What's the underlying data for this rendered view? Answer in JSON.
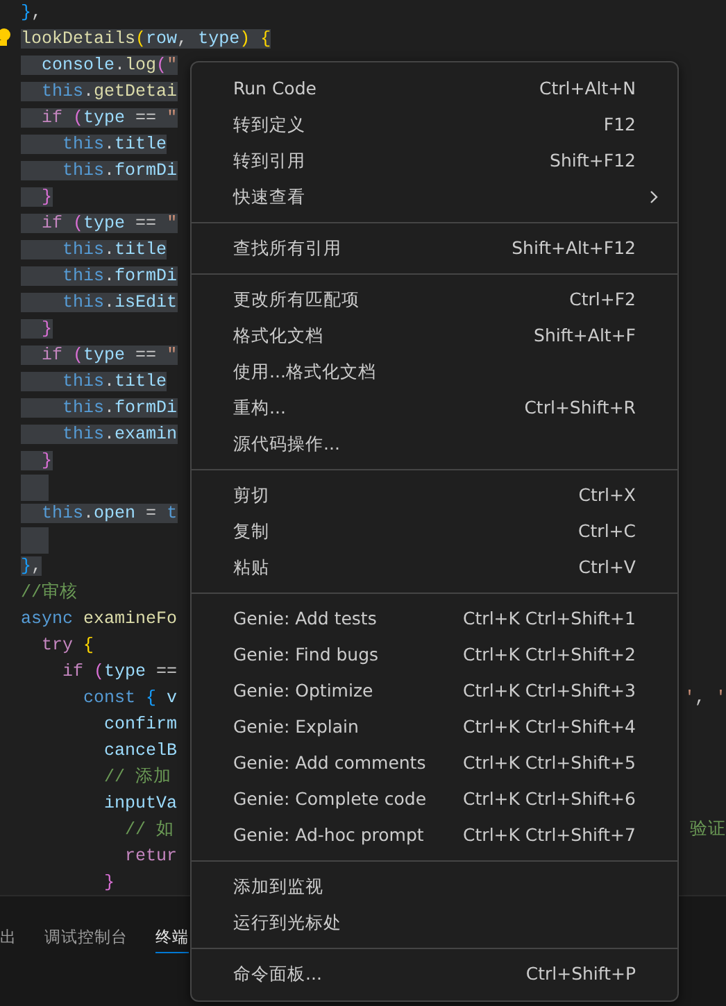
{
  "editor": {
    "lines": [
      {
        "selected": false,
        "tokens": [
          {
            "kind": "b3",
            "text": "}"
          },
          {
            "kind": "plain",
            "text": ","
          }
        ]
      },
      {
        "selected": true,
        "tokens": [
          {
            "kind": "fn",
            "text": "lookDetails"
          },
          {
            "kind": "b1",
            "text": "("
          },
          {
            "kind": "var",
            "text": "row"
          },
          {
            "kind": "plain",
            "text": ", "
          },
          {
            "kind": "var",
            "text": "type"
          },
          {
            "kind": "b1",
            "text": ")"
          },
          {
            "kind": "b1",
            "text": " {"
          }
        ]
      },
      {
        "selected": true,
        "tokens": [
          {
            "kind": "var",
            "text": "  console"
          },
          {
            "kind": "plain",
            "text": "."
          },
          {
            "kind": "fn",
            "text": "log"
          },
          {
            "kind": "b2",
            "text": "("
          },
          {
            "kind": "str",
            "text": "\""
          }
        ]
      },
      {
        "selected": true,
        "tokens": [
          {
            "kind": "storage",
            "text": "  this"
          },
          {
            "kind": "plain",
            "text": "."
          },
          {
            "kind": "fn",
            "text": "getDetai"
          }
        ]
      },
      {
        "selected": true,
        "tokens": [
          {
            "kind": "kw",
            "text": "  if "
          },
          {
            "kind": "b2",
            "text": "("
          },
          {
            "kind": "var",
            "text": "type"
          },
          {
            "kind": "plain",
            "text": " == "
          },
          {
            "kind": "str",
            "text": "\""
          }
        ]
      },
      {
        "selected": true,
        "tokens": [
          {
            "kind": "storage",
            "text": "    this"
          },
          {
            "kind": "plain",
            "text": "."
          },
          {
            "kind": "var",
            "text": "title"
          }
        ]
      },
      {
        "selected": true,
        "tokens": [
          {
            "kind": "storage",
            "text": "    this"
          },
          {
            "kind": "plain",
            "text": "."
          },
          {
            "kind": "var",
            "text": "formDi"
          }
        ]
      },
      {
        "selected": true,
        "tokens": [
          {
            "kind": "b2",
            "text": "  }"
          }
        ]
      },
      {
        "selected": true,
        "tokens": [
          {
            "kind": "kw",
            "text": "  if "
          },
          {
            "kind": "b2",
            "text": "("
          },
          {
            "kind": "var",
            "text": "type"
          },
          {
            "kind": "plain",
            "text": " == "
          },
          {
            "kind": "str",
            "text": "\""
          }
        ]
      },
      {
        "selected": true,
        "tokens": [
          {
            "kind": "storage",
            "text": "    this"
          },
          {
            "kind": "plain",
            "text": "."
          },
          {
            "kind": "var",
            "text": "title"
          }
        ]
      },
      {
        "selected": true,
        "tokens": [
          {
            "kind": "storage",
            "text": "    this"
          },
          {
            "kind": "plain",
            "text": "."
          },
          {
            "kind": "var",
            "text": "formDi"
          }
        ]
      },
      {
        "selected": true,
        "tokens": [
          {
            "kind": "storage",
            "text": "    this"
          },
          {
            "kind": "plain",
            "text": "."
          },
          {
            "kind": "var",
            "text": "isEdit"
          }
        ]
      },
      {
        "selected": true,
        "tokens": [
          {
            "kind": "b2",
            "text": "  }"
          }
        ]
      },
      {
        "selected": true,
        "tokens": [
          {
            "kind": "kw",
            "text": "  if "
          },
          {
            "kind": "b2",
            "text": "("
          },
          {
            "kind": "var",
            "text": "type"
          },
          {
            "kind": "plain",
            "text": " == "
          },
          {
            "kind": "str",
            "text": "\""
          }
        ]
      },
      {
        "selected": true,
        "tokens": [
          {
            "kind": "storage",
            "text": "    this"
          },
          {
            "kind": "plain",
            "text": "."
          },
          {
            "kind": "var",
            "text": "title"
          }
        ]
      },
      {
        "selected": true,
        "tokens": [
          {
            "kind": "storage",
            "text": "    this"
          },
          {
            "kind": "plain",
            "text": "."
          },
          {
            "kind": "var",
            "text": "formDi"
          }
        ]
      },
      {
        "selected": true,
        "tokens": [
          {
            "kind": "storage",
            "text": "    this"
          },
          {
            "kind": "plain",
            "text": "."
          },
          {
            "kind": "var",
            "text": "examin"
          }
        ]
      },
      {
        "selected": true,
        "tokens": [
          {
            "kind": "b2",
            "text": "  }"
          }
        ]
      },
      {
        "selected": true
      },
      {
        "selected": true,
        "tokens": [
          {
            "kind": "storage",
            "text": "  this"
          },
          {
            "kind": "plain",
            "text": "."
          },
          {
            "kind": "var",
            "text": "open"
          },
          {
            "kind": "plain",
            "text": " = "
          },
          {
            "kind": "storage",
            "text": "t"
          }
        ]
      },
      {
        "selected": true
      },
      {
        "selected": true,
        "tokens": [
          {
            "kind": "b3",
            "text": "}"
          },
          {
            "kind": "plain",
            "text": ","
          }
        ]
      },
      {
        "selected": false,
        "tokens": [
          {
            "kind": "com",
            "text": "//审核"
          }
        ]
      },
      {
        "selected": false,
        "tokens": [
          {
            "kind": "storage",
            "text": "async "
          },
          {
            "kind": "fn",
            "text": "examineFo"
          }
        ]
      },
      {
        "selected": false,
        "tokens": [
          {
            "kind": "kw",
            "text": "  try "
          },
          {
            "kind": "b1",
            "text": "{"
          }
        ]
      },
      {
        "selected": false,
        "tokens": [
          {
            "kind": "kw",
            "text": "    if "
          },
          {
            "kind": "b2",
            "text": "("
          },
          {
            "kind": "var",
            "text": "type"
          },
          {
            "kind": "plain",
            "text": " =="
          }
        ]
      },
      {
        "selected": false,
        "tokens": [
          {
            "kind": "storage",
            "text": "      const "
          },
          {
            "kind": "b3",
            "text": "{ "
          },
          {
            "kind": "var",
            "text": "v"
          }
        ],
        "right": [
          {
            "kind": "str",
            "text": "'"
          },
          {
            "kind": "plain",
            "text": ", "
          },
          {
            "kind": "str",
            "text": "'"
          }
        ]
      },
      {
        "selected": false,
        "tokens": [
          {
            "kind": "var",
            "text": "        confirm"
          }
        ]
      },
      {
        "selected": false,
        "tokens": [
          {
            "kind": "var",
            "text": "        cancelB"
          }
        ]
      },
      {
        "selected": false,
        "tokens": [
          {
            "kind": "com",
            "text": "        // 添加"
          }
        ]
      },
      {
        "selected": false,
        "tokens": [
          {
            "kind": "var",
            "text": "        inputVa"
          }
        ]
      },
      {
        "selected": false,
        "tokens": [
          {
            "kind": "com",
            "text": "          // 如"
          }
        ],
        "right": [
          {
            "kind": "com",
            "text": "验证"
          }
        ]
      },
      {
        "selected": false,
        "tokens": [
          {
            "kind": "kw",
            "text": "          retur"
          }
        ]
      },
      {
        "selected": false,
        "tokens": [
          {
            "kind": "b2",
            "text": "        }"
          }
        ]
      }
    ]
  },
  "panel": {
    "tabs": [
      {
        "label": "出",
        "selected": false
      },
      {
        "label": "调试控制台",
        "selected": false
      },
      {
        "label": "终端",
        "selected": true
      }
    ]
  },
  "context_menu": {
    "groups": [
      [
        {
          "label": "Run Code",
          "shortcut": "Ctrl+Alt+N",
          "submenu": false
        },
        {
          "label": "转到定义",
          "shortcut": "F12",
          "submenu": false
        },
        {
          "label": "转到引用",
          "shortcut": "Shift+F12",
          "submenu": false
        },
        {
          "label": "快速查看",
          "submenu": true
        }
      ],
      [
        {
          "label": "查找所有引用",
          "shortcut": "Shift+Alt+F12",
          "submenu": false
        }
      ],
      [
        {
          "label": "更改所有匹配项",
          "shortcut": "Ctrl+F2",
          "submenu": false
        },
        {
          "label": "格式化文档",
          "shortcut": "Shift+Alt+F",
          "submenu": false
        },
        {
          "label": "使用...格式化文档",
          "submenu": false
        },
        {
          "label": "重构...",
          "shortcut": "Ctrl+Shift+R",
          "submenu": false
        },
        {
          "label": "源代码操作...",
          "submenu": false
        }
      ],
      [
        {
          "label": "剪切",
          "shortcut": "Ctrl+X",
          "submenu": false
        },
        {
          "label": "复制",
          "shortcut": "Ctrl+C",
          "submenu": false
        },
        {
          "label": "粘贴",
          "shortcut": "Ctrl+V",
          "submenu": false
        }
      ],
      [
        {
          "label": "Genie: Add tests",
          "shortcut": "Ctrl+K Ctrl+Shift+1",
          "submenu": false
        },
        {
          "label": "Genie: Find bugs",
          "shortcut": "Ctrl+K Ctrl+Shift+2",
          "submenu": false
        },
        {
          "label": "Genie: Optimize",
          "shortcut": "Ctrl+K Ctrl+Shift+3",
          "submenu": false
        },
        {
          "label": "Genie: Explain",
          "shortcut": "Ctrl+K Ctrl+Shift+4",
          "submenu": false
        },
        {
          "label": "Genie: Add comments",
          "shortcut": "Ctrl+K Ctrl+Shift+5",
          "submenu": false
        },
        {
          "label": "Genie: Complete code",
          "shortcut": "Ctrl+K Ctrl+Shift+6",
          "submenu": false
        },
        {
          "label": "Genie: Ad-hoc prompt",
          "shortcut": "Ctrl+K Ctrl+Shift+7",
          "submenu": false
        }
      ],
      [
        {
          "label": "添加到监视",
          "submenu": false
        },
        {
          "label": "运行到光标处",
          "submenu": false
        }
      ],
      [
        {
          "label": "命令面板...",
          "shortcut": "Ctrl+Shift+P",
          "submenu": false
        }
      ]
    ]
  }
}
